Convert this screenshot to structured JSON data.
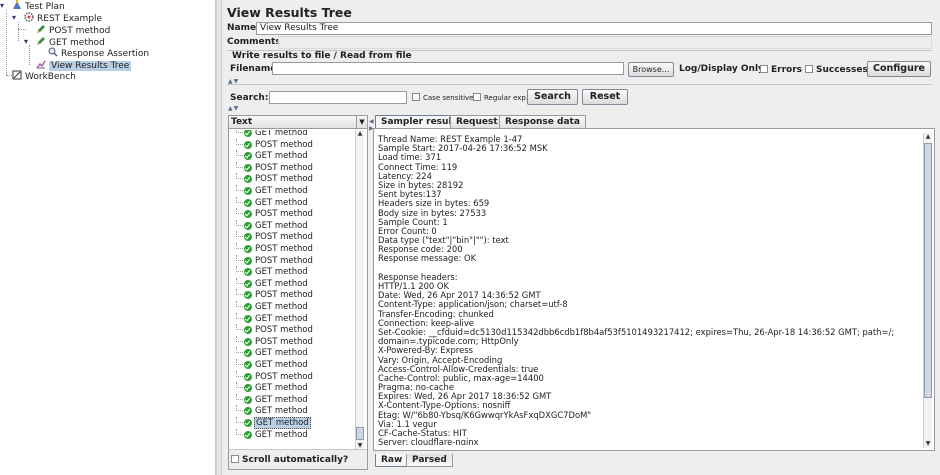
{
  "tree": {
    "items": [
      {
        "label": "Test Plan",
        "icon": "test-plan-icon"
      },
      {
        "label": "REST Example",
        "icon": "thread-group-gear-icon"
      },
      {
        "label": "POST method",
        "icon": "sampler-pencil-icon"
      },
      {
        "label": "GET method",
        "icon": "sampler-pencil-icon"
      },
      {
        "label": "Response Assertion",
        "icon": "magnifier-icon"
      },
      {
        "label": "View Results Tree",
        "icon": "listener-chart-icon"
      },
      {
        "label": "WorkBench",
        "icon": "workbench-icon"
      }
    ],
    "selected": "View Results Tree"
  },
  "panel": {
    "title": "View Results Tree",
    "name_label": "Name:",
    "name_value": "View Results Tree",
    "comments_label": "Comments:",
    "comments_value": "",
    "write_results_label": "Write results to file / Read from file",
    "filename_label": "Filename",
    "filename_value": "",
    "browse_label": "Browse...",
    "log_display_label": "Log/Display Only:",
    "errors_label": "Errors",
    "successes_label": "Successes",
    "configure_label": "Configure"
  },
  "search": {
    "label": "Search:",
    "value": "",
    "case_sensitive_label": "Case sensitive",
    "regex_label": "Regular exp.",
    "search_button": "Search",
    "reset_button": "Reset"
  },
  "results_list": {
    "header": "Text",
    "items": [
      "GET method",
      "POST method",
      "GET method",
      "POST method",
      "POST method",
      "GET method",
      "GET method",
      "POST method",
      "GET method",
      "POST method",
      "POST method",
      "POST method",
      "GET method",
      "GET method",
      "POST method",
      "GET method",
      "GET method",
      "POST method",
      "POST method",
      "GET method",
      "GET method",
      "POST method",
      "GET method",
      "GET method",
      "GET method",
      "GET method",
      "GET method"
    ],
    "selected_index": 25,
    "scroll_auto_label": "Scroll automatically?"
  },
  "detail": {
    "tabs": [
      "Sampler result",
      "Request",
      "Response data"
    ],
    "active_tab": "Sampler result",
    "lines": [
      "Thread Name: REST Example 1-47",
      "Sample Start: 2017-04-26 17:36:52 MSK",
      "Load time: 371",
      "Connect Time: 119",
      "Latency: 224",
      "Size in bytes: 28192",
      "Sent bytes:137",
      "Headers size in bytes: 659",
      "Body size in bytes: 27533",
      "Sample Count: 1",
      "Error Count: 0",
      "Data type (\"text\"|\"bin\"|\"\"): text",
      "Response code: 200",
      "Response message: OK",
      "",
      "Response headers:",
      "HTTP/1.1 200 OK",
      "Date: Wed, 26 Apr 2017 14:36:52 GMT",
      "Content-Type: application/json; charset=utf-8",
      "Transfer-Encoding: chunked",
      "Connection: keep-alive",
      "Set-Cookie: __cfduid=dc5130d115342dbb6cdb1f8b4af53f5101493217412; expires=Thu, 26-Apr-18 14:36:52 GMT; path=/;",
      "domain=.typicode.com; HttpOnly",
      "X-Powered-By: Express",
      "Vary: Origin, Accept-Encoding",
      "Access-Control-Allow-Credentials: true",
      "Cache-Control: public, max-age=14400",
      "Pragma: no-cache",
      "Expires: Wed, 26 Apr 2017 18:36:52 GMT",
      "X-Content-Type-Options: nosniff",
      "Etag: W/\"6b80-Ybsq/K6GwwqrYkAsFxqDXGC7DoM\"",
      "Via: 1.1 vegur",
      "CF-Cache-Status: HIT",
      "Server: cloudflare-nginx"
    ],
    "bottom_tabs": [
      "Raw",
      "Parsed"
    ],
    "active_bottom_tab": "Raw"
  }
}
